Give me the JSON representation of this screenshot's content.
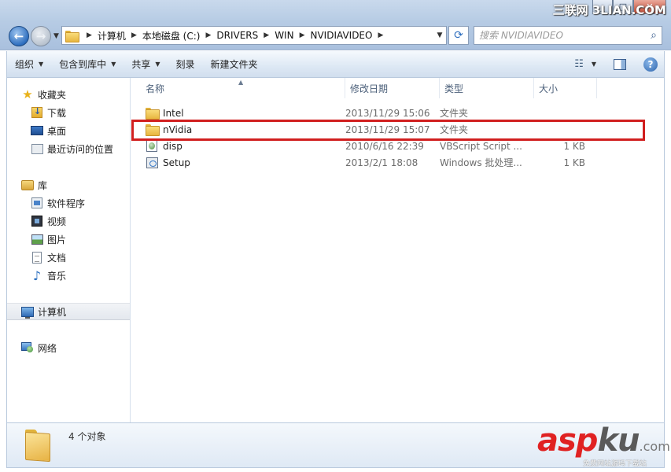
{
  "watermark_top": "三联网 3LIAN.COM",
  "address": {
    "crumbs": [
      "计算机",
      "本地磁盘 (C:)",
      "DRIVERS",
      "WIN",
      "NVIDIAVIDEO"
    ]
  },
  "search": {
    "placeholder": "搜索 NVIDIAVIDEO"
  },
  "toolbar": {
    "organize": "组织",
    "include_library": "包含到库中",
    "share": "共享",
    "burn": "刻录",
    "new_folder": "新建文件夹"
  },
  "nav": {
    "favorites": "收藏夹",
    "favorites_items": [
      "下载",
      "桌面",
      "最近访问的位置"
    ],
    "libraries": "库",
    "library_items": [
      "软件程序",
      "视频",
      "图片",
      "文档",
      "音乐"
    ],
    "computer": "计算机",
    "network": "网络"
  },
  "columns": {
    "name": "名称",
    "date": "修改日期",
    "type": "类型",
    "size": "大小"
  },
  "files": [
    {
      "name": "Intel",
      "date": "2013/11/29 15:06",
      "type": "文件夹",
      "size": "",
      "icon": "folder-icon"
    },
    {
      "name": "nVidia",
      "date": "2013/11/29 15:07",
      "type": "文件夹",
      "size": "",
      "icon": "folder-icon"
    },
    {
      "name": "disp",
      "date": "2010/6/16 22:39",
      "type": "VBScript Script ...",
      "size": "1 KB",
      "icon": "vbscript-file-icon"
    },
    {
      "name": "Setup",
      "date": "2013/2/1 18:08",
      "type": "Windows 批处理...",
      "size": "1 KB",
      "icon": "batch-file-icon"
    }
  ],
  "status": {
    "count": "4 个对象"
  },
  "watermark_bottom": {
    "brand_a": "asp",
    "brand_b": "ku",
    "suffix": ".com",
    "sub": "免费网站源码下载站"
  },
  "colors": {
    "highlight": "#d11f1f",
    "brand_red": "#e02222"
  }
}
